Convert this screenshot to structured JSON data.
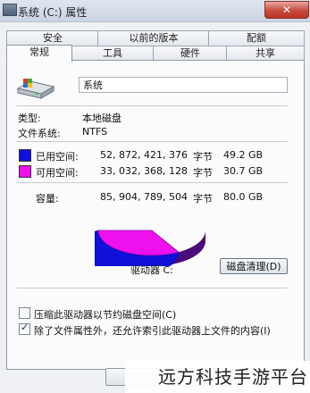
{
  "window": {
    "title": "系统 (C:) 属性",
    "close_glyph": "✕"
  },
  "tabs_row1": [
    "安全",
    "以前的版本",
    "配额"
  ],
  "tabs_row2": [
    "常规",
    "工具",
    "硬件",
    "共享"
  ],
  "general": {
    "volume_name": "系统",
    "type_label": "类型:",
    "type_value": "本地磁盘",
    "fs_label": "文件系统:",
    "fs_value": "NTFS",
    "used": {
      "label": "已用空间:",
      "bytes": "52, 872, 421, 376",
      "unit": "字节",
      "size": "49.2 GB",
      "color": "#1010e0"
    },
    "free": {
      "label": "可用空间:",
      "bytes": "33, 032, 368, 128",
      "unit": "字节",
      "size": "30.7 GB",
      "color": "#ee10ee"
    },
    "capacity": {
      "label": "容量:",
      "bytes": "85, 904, 789, 504",
      "unit": "字节",
      "size": "80.0 GB"
    },
    "drive_label": "驱动器 C:",
    "cleanup_button": "磁盘清理(D)",
    "compress_label": "压缩此驱动器以节约磁盘空间(C)",
    "compress_checked": false,
    "index_label": "除了文件属性外，还允许索引此驱动器上文件的内容(I)",
    "index_checked": true
  },
  "watermark": "远方科技手游平台"
}
